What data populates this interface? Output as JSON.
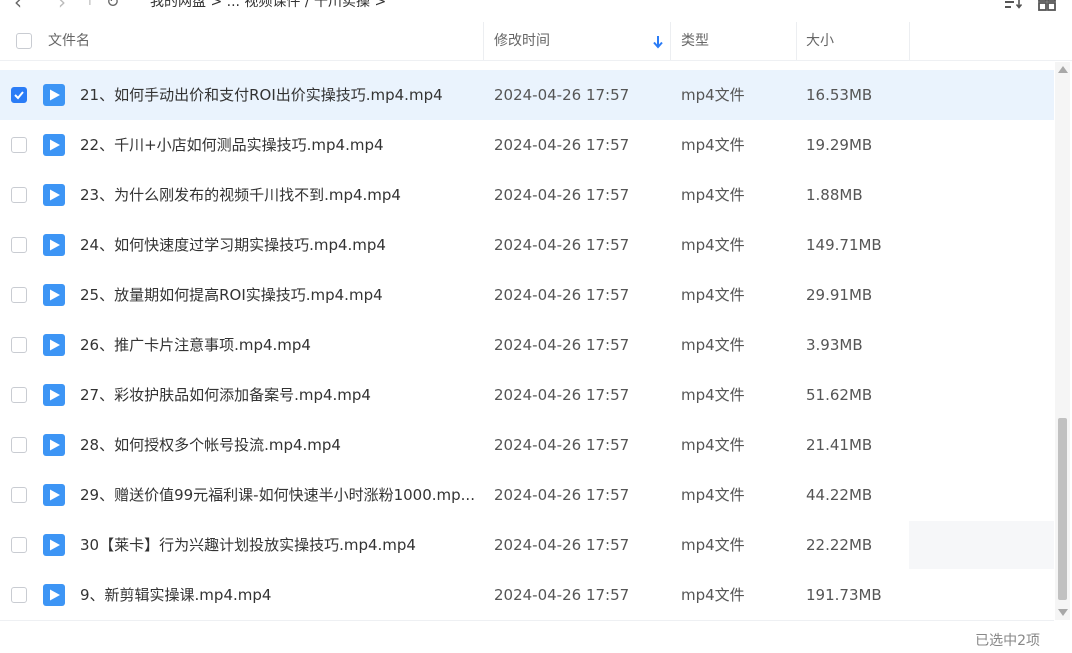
{
  "toolbar": {
    "breadcrumb_text": "我的网盘  >  ...  视频课件 / 千川实操  >"
  },
  "header": {
    "name_label": "文件名",
    "modified_label": "修改时间",
    "type_label": "类型",
    "size_label": "大小"
  },
  "colors": {
    "accent": "#2b7cf6",
    "selected_row": "#eaf3fd",
    "file_icon": "#3d95f5"
  },
  "files": [
    {
      "name": "21、如何手动出价和支付ROI出价实操技巧.mp4.mp4",
      "modified": "2024-04-26 17:57",
      "type": "mp4文件",
      "size": "16.53MB",
      "checked": true
    },
    {
      "name": "22、千川+小店如何测品实操技巧.mp4.mp4",
      "modified": "2024-04-26 17:57",
      "type": "mp4文件",
      "size": "19.29MB",
      "checked": false
    },
    {
      "name": "23、为什么刚发布的视频千川找不到.mp4.mp4",
      "modified": "2024-04-26 17:57",
      "type": "mp4文件",
      "size": "1.88MB",
      "checked": false
    },
    {
      "name": "24、如何快速度过学习期实操技巧.mp4.mp4",
      "modified": "2024-04-26 17:57",
      "type": "mp4文件",
      "size": "149.71MB",
      "checked": false
    },
    {
      "name": "25、放量期如何提高ROI实操技巧.mp4.mp4",
      "modified": "2024-04-26 17:57",
      "type": "mp4文件",
      "size": "29.91MB",
      "checked": false
    },
    {
      "name": "26、推广卡片注意事项.mp4.mp4",
      "modified": "2024-04-26 17:57",
      "type": "mp4文件",
      "size": "3.93MB",
      "checked": false
    },
    {
      "name": "27、彩妆护肤品如何添加备案号.mp4.mp4",
      "modified": "2024-04-26 17:57",
      "type": "mp4文件",
      "size": "51.62MB",
      "checked": false
    },
    {
      "name": "28、如何授权多个帐号投流.mp4.mp4",
      "modified": "2024-04-26 17:57",
      "type": "mp4文件",
      "size": "21.41MB",
      "checked": false
    },
    {
      "name": "29、赠送价值99元福利课-如何快速半小时涨粉1000.mp...",
      "modified": "2024-04-26 17:57",
      "type": "mp4文件",
      "size": "44.22MB",
      "checked": false
    },
    {
      "name": "30【莱卡】行为兴趣计划投放实操技巧.mp4.mp4",
      "modified": "2024-04-26 17:57",
      "type": "mp4文件",
      "size": "22.22MB",
      "checked": false
    },
    {
      "name": "9、新剪辑实操课.mp4.mp4",
      "modified": "2024-04-26 17:57",
      "type": "mp4文件",
      "size": "191.73MB",
      "checked": false
    }
  ],
  "status": {
    "selection_text": "已选中2项"
  }
}
